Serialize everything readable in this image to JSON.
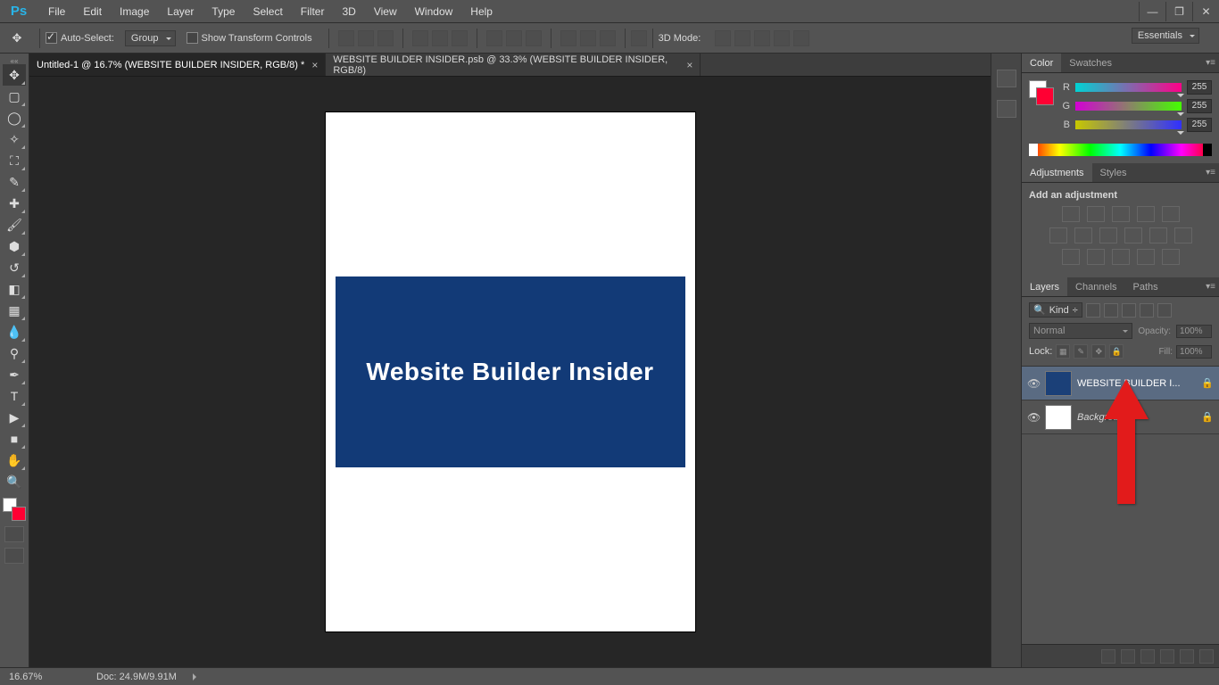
{
  "app_logo": "Ps",
  "menu": [
    "File",
    "Edit",
    "Image",
    "Layer",
    "Type",
    "Select",
    "Filter",
    "3D",
    "View",
    "Window",
    "Help"
  ],
  "options": {
    "auto_select": "Auto-Select:",
    "group": "Group",
    "show_transform": "Show Transform Controls",
    "mode_3d": "3D Mode:",
    "workspace": "Essentials"
  },
  "tabs": [
    {
      "label": "Untitled-1 @ 16.7% (WEBSITE BUILDER INSIDER, RGB/8) *",
      "active": true
    },
    {
      "label": "WEBSITE BUILDER INSIDER.psb @ 33.3% (WEBSITE BUILDER INSIDER, RGB/8)",
      "active": false
    }
  ],
  "canvas_text": "Website Builder Insider",
  "color_panel": {
    "tabs": [
      "Color",
      "Swatches"
    ],
    "channels": [
      {
        "label": "R",
        "value": "255"
      },
      {
        "label": "G",
        "value": "255"
      },
      {
        "label": "B",
        "value": "255"
      }
    ]
  },
  "adjustments_panel": {
    "tabs": [
      "Adjustments",
      "Styles"
    ],
    "hint": "Add an adjustment"
  },
  "layers_panel": {
    "tabs": [
      "Layers",
      "Channels",
      "Paths"
    ],
    "kind": "Kind",
    "blend": "Normal",
    "opacity_label": "Opacity:",
    "opacity_value": "100%",
    "lock_label": "Lock:",
    "fill_label": "Fill:",
    "fill_value": "100%",
    "layers": [
      {
        "name": "WEBSITE BUILDER I...",
        "locked": true,
        "selected": true,
        "thumb": "so"
      },
      {
        "name": "Background",
        "locked": true,
        "selected": false,
        "thumb": "bg",
        "italic": true
      }
    ]
  },
  "status": {
    "zoom": "16.67%",
    "doc": "Doc: 24.9M/9.91M"
  }
}
